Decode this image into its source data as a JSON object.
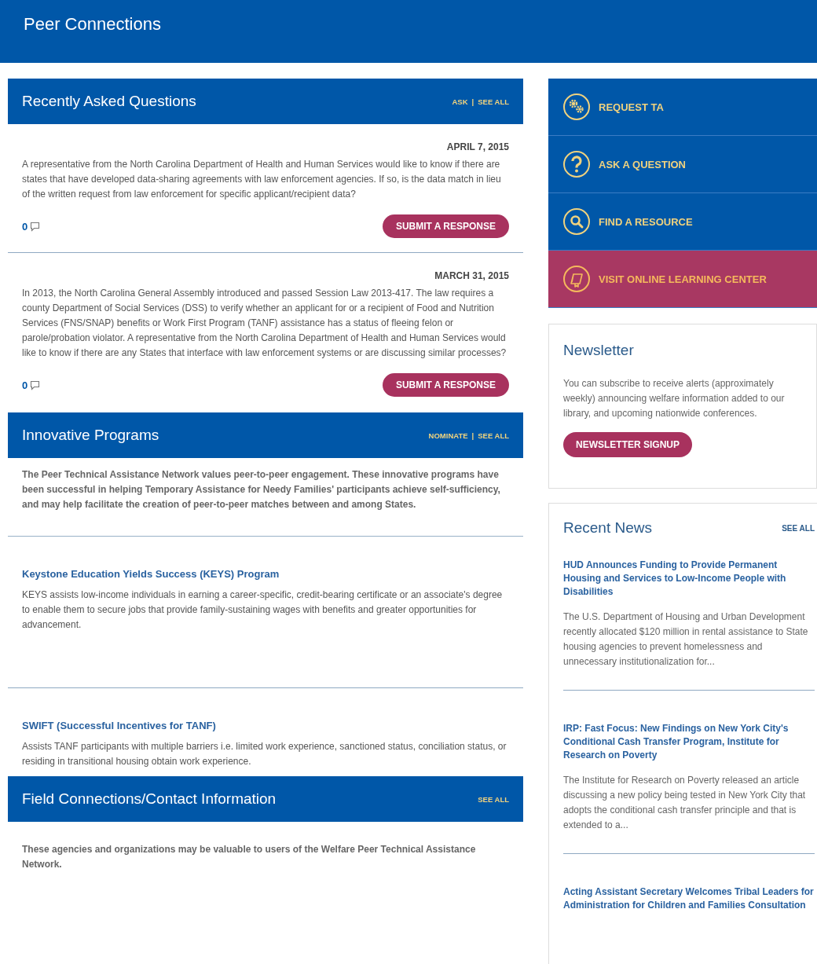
{
  "page": {
    "title": "Peer Connections"
  },
  "questions_section": {
    "title": "Recently Asked Questions",
    "links": [
      "ASK",
      "SEE ALL"
    ],
    "separator": "|",
    "questions": [
      {
        "date": "APRIL 7, 2015",
        "text": "A representative from the North Carolina Department of Health and Human Services would like to know if there are states that have developed data-sharing agreements with law enforcement agencies. If so, is the data match in lieu of the written request from law enforcement for specific applicant/recipient data?",
        "count": "0",
        "button": "SUBMIT A RESPONSE"
      },
      {
        "date": "MARCH 31, 2015",
        "text": "In 2013, the North Carolina General Assembly introduced and passed Session Law 2013-417. The law requires a county Department of Social Services (DSS) to verify whether an applicant for or a recipient of Food and Nutrition Services (FNS/SNAP) benefits or Work First Program (TANF) assistance has a status of fleeing felon or parole/probation violator. A representative from the North Carolina Department of Health and Human Services would like to know if there are any States that interface with law enforcement systems or are discussing similar processes?",
        "count": "0",
        "button": "SUBMIT A RESPONSE"
      }
    ]
  },
  "programs_section": {
    "title": "Innovative Programs",
    "links": [
      "NOMINATE",
      "SEE ALL"
    ],
    "separator": "|",
    "intro": "The Peer Technical Assistance Network values peer-to-peer engagement. These innovative programs have been successful in helping Temporary Assistance for Needy Families' participants achieve self-sufficiency, and may help facilitate the creation of peer-to-peer matches between and among States.",
    "programs": [
      {
        "title": "Keystone Education Yields Success (KEYS) Program",
        "text": "KEYS assists low-income individuals in earning a career-specific, credit-bearing certificate or an associate's degree to enable them to secure jobs that provide family-sustaining wages with benefits and greater opportunities for advancement."
      },
      {
        "title": "SWIFT (Successful Incentives for TANF)",
        "text": "Assists TANF participants with multiple barriers i.e. limited work experience, sanctioned status, conciliation status, or residing in transitional housing obtain work experience."
      }
    ]
  },
  "field_section": {
    "title": "Field Connections/Contact Information",
    "links": [
      "SEE ALL"
    ],
    "intro": "These agencies and organizations may be valuable to users of the Welfare Peer Technical Assistance Network."
  },
  "actions": [
    {
      "label": "REQUEST TA",
      "kind": "gears",
      "color": "#0057a8"
    },
    {
      "label": "ASK A QUESTION",
      "kind": "question",
      "color": "#0057a8"
    },
    {
      "label": "FIND A RESOURCE",
      "kind": "search",
      "color": "#0057a8"
    },
    {
      "label": "VISIT ONLINE LEARNING CENTER",
      "kind": "learning",
      "color": "#a83862"
    }
  ],
  "newsletter": {
    "title": "Newsletter",
    "text": "You can subscribe to receive alerts (approximately weekly) announcing welfare information added to our library, and upcoming nationwide conferences.",
    "button": "NEWSLETTER SIGNUP"
  },
  "recent_news": {
    "title": "Recent News",
    "see_all": "SEE ALL",
    "items": [
      {
        "title": "HUD Announces Funding to Provide Permanent Housing and Services to Low-Income People with Disabilities",
        "summary": "The U.S. Department of Housing and Urban Development recently allocated $120 million in rental assistance to State housing agencies to prevent homelessness and unnecessary institutionalization for..."
      },
      {
        "title": "IRP: Fast Focus: New Findings on New York City's Conditional Cash Transfer Program, Institute for Research on Poverty",
        "summary": "The Institute for Research on Poverty released an article discussing a new policy being tested in New York City that adopts the conditional cash transfer principle and that is extended to a..."
      },
      {
        "title": "Acting Assistant Secretary Welcomes Tribal Leaders for Administration for Children and Families Consultation"
      }
    ]
  }
}
